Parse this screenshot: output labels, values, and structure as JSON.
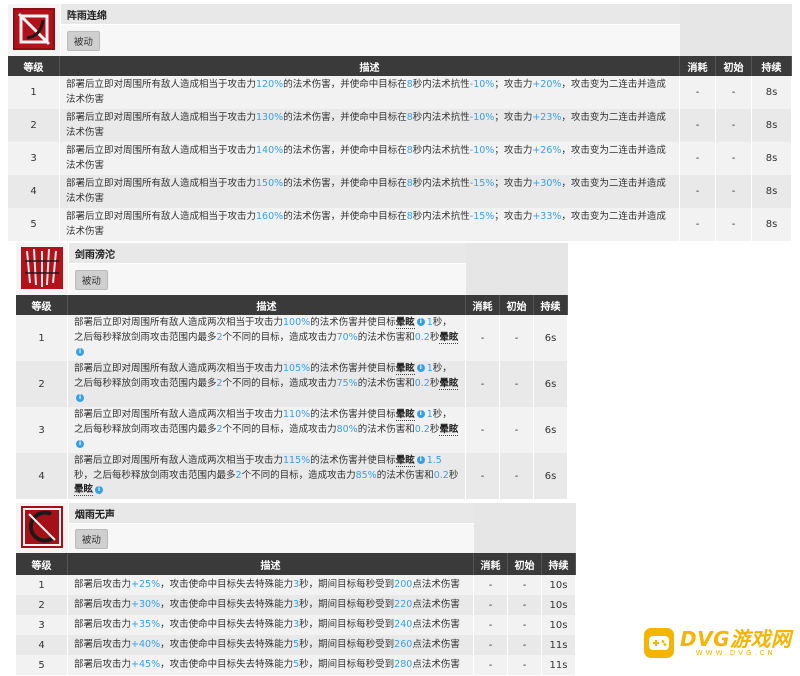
{
  "headers": {
    "level": "等级",
    "desc": "描述",
    "sp_cost": "消耗",
    "init_sp": "初始",
    "duration": "持续"
  },
  "skills": [
    {
      "name": "阵雨连绵",
      "tag": "被动",
      "icon": "skill-emblem-icon",
      "rows": [
        {
          "level": "1",
          "sp_cost": "-",
          "init_sp": "-",
          "duration": "8s",
          "desc": [
            [
              "部署后立即对周围所有敌人造成相当于攻击力",
              ""
            ],
            [
              "120%",
              "hl"
            ],
            [
              "的法术伤害，并使命中目标在",
              ""
            ],
            [
              "8",
              "hl"
            ],
            [
              "秒内法术抗性",
              ""
            ],
            [
              "-10%",
              "hl"
            ],
            [
              "；攻击力",
              ""
            ],
            [
              "+20%",
              "hl"
            ],
            [
              "，攻击变为二连击并造成法术伤害",
              ""
            ]
          ]
        },
        {
          "level": "2",
          "sp_cost": "-",
          "init_sp": "-",
          "duration": "8s",
          "desc": [
            [
              "部署后立即对周围所有敌人造成相当于攻击力",
              ""
            ],
            [
              "130%",
              "hl"
            ],
            [
              "的法术伤害，并使命中目标在",
              ""
            ],
            [
              "8",
              "hl"
            ],
            [
              "秒内法术抗性",
              ""
            ],
            [
              "-10%",
              "hl"
            ],
            [
              "；攻击力",
              ""
            ],
            [
              "+23%",
              "hl"
            ],
            [
              "，攻击变为二连击并造成法术伤害",
              ""
            ]
          ]
        },
        {
          "level": "3",
          "sp_cost": "-",
          "init_sp": "-",
          "duration": "8s",
          "desc": [
            [
              "部署后立即对周围所有敌人造成相当于攻击力",
              ""
            ],
            [
              "140%",
              "hl"
            ],
            [
              "的法术伤害，并使命中目标在",
              ""
            ],
            [
              "8",
              "hl"
            ],
            [
              "秒内法术抗性",
              ""
            ],
            [
              "-10%",
              "hl"
            ],
            [
              "；攻击力",
              ""
            ],
            [
              "+26%",
              "hl"
            ],
            [
              "，攻击变为二连击并造成法术伤害",
              ""
            ]
          ]
        },
        {
          "level": "4",
          "sp_cost": "-",
          "init_sp": "-",
          "duration": "8s",
          "desc": [
            [
              "部署后立即对周围所有敌人造成相当于攻击力",
              ""
            ],
            [
              "150%",
              "hl"
            ],
            [
              "的法术伤害，并使命中目标在",
              ""
            ],
            [
              "8",
              "hl"
            ],
            [
              "秒内法术抗性",
              ""
            ],
            [
              "-15%",
              "hl"
            ],
            [
              "；攻击力",
              ""
            ],
            [
              "+30%",
              "hl"
            ],
            [
              "，攻击变为二连击并造成法术伤害",
              ""
            ]
          ]
        },
        {
          "level": "5",
          "sp_cost": "-",
          "init_sp": "-",
          "duration": "8s",
          "desc": [
            [
              "部署后立即对周围所有敌人造成相当于攻击力",
              ""
            ],
            [
              "160%",
              "hl"
            ],
            [
              "的法术伤害，并使命中目标在",
              ""
            ],
            [
              "8",
              "hl"
            ],
            [
              "秒内法术抗性",
              ""
            ],
            [
              "-15%",
              "hl"
            ],
            [
              "；攻击力",
              ""
            ],
            [
              "+33%",
              "hl"
            ],
            [
              "，攻击变为二连击并造成法术伤害",
              ""
            ]
          ]
        }
      ]
    },
    {
      "name": "剑雨滂沱",
      "tag": "被动",
      "icon": "skill-sword-rain-icon",
      "rows": [
        {
          "level": "1",
          "sp_cost": "-",
          "init_sp": "-",
          "duration": "6s",
          "desc": [
            [
              "部署后立即对周围所有敌人造成两次相当于攻击力",
              ""
            ],
            [
              "100%",
              "hl"
            ],
            [
              "的法术伤害并使目标",
              ""
            ],
            [
              "晕眩",
              "kw"
            ],
            [
              "i",
              "info"
            ],
            [
              "1",
              "hl"
            ],
            [
              "秒，之后每秒释放剑雨攻击范围内最多",
              ""
            ],
            [
              "2",
              "hl"
            ],
            [
              "个不同的目标，造成攻击力",
              ""
            ],
            [
              "70%",
              "hl"
            ],
            [
              "的法术伤害和",
              ""
            ],
            [
              "0.2",
              "hl"
            ],
            [
              "秒",
              ""
            ],
            [
              "晕眩",
              "kw"
            ],
            [
              "i",
              "info"
            ]
          ]
        },
        {
          "level": "2",
          "sp_cost": "-",
          "init_sp": "-",
          "duration": "6s",
          "desc": [
            [
              "部署后立即对周围所有敌人造成两次相当于攻击力",
              ""
            ],
            [
              "105%",
              "hl"
            ],
            [
              "的法术伤害并使目标",
              ""
            ],
            [
              "晕眩",
              "kw"
            ],
            [
              "i",
              "info"
            ],
            [
              "1",
              "hl"
            ],
            [
              "秒，之后每秒释放剑雨攻击范围内最多",
              ""
            ],
            [
              "2",
              "hl"
            ],
            [
              "个不同的目标，造成攻击力",
              ""
            ],
            [
              "75%",
              "hl"
            ],
            [
              "的法术伤害和",
              ""
            ],
            [
              "0.2",
              "hl"
            ],
            [
              "秒",
              ""
            ],
            [
              "晕眩",
              "kw"
            ],
            [
              "i",
              "info"
            ]
          ]
        },
        {
          "level": "3",
          "sp_cost": "-",
          "init_sp": "-",
          "duration": "6s",
          "desc": [
            [
              "部署后立即对周围所有敌人造成两次相当于攻击力",
              ""
            ],
            [
              "110%",
              "hl"
            ],
            [
              "的法术伤害并使目标",
              ""
            ],
            [
              "晕眩",
              "kw"
            ],
            [
              "i",
              "info"
            ],
            [
              "1",
              "hl"
            ],
            [
              "秒，之后每秒释放剑雨攻击范围内最多",
              ""
            ],
            [
              "2",
              "hl"
            ],
            [
              "个不同的目标，造成攻击力",
              ""
            ],
            [
              "80%",
              "hl"
            ],
            [
              "的法术伤害和",
              ""
            ],
            [
              "0.2",
              "hl"
            ],
            [
              "秒",
              ""
            ],
            [
              "晕眩",
              "kw"
            ],
            [
              "i",
              "info"
            ]
          ]
        },
        {
          "level": "4",
          "sp_cost": "-",
          "init_sp": "-",
          "duration": "6s",
          "desc": [
            [
              "部署后立即对周围所有敌人造成两次相当于攻击力",
              ""
            ],
            [
              "115%",
              "hl"
            ],
            [
              "的法术伤害并使目标",
              ""
            ],
            [
              "晕眩",
              "kw"
            ],
            [
              "i",
              "info"
            ],
            [
              "1.5",
              "hl"
            ],
            [
              "秒，之后每秒释放剑雨攻击范围内最多",
              ""
            ],
            [
              "2",
              "hl"
            ],
            [
              "个不同的目标，造成攻击力",
              ""
            ],
            [
              "85%",
              "hl"
            ],
            [
              "的法术伤害和",
              ""
            ],
            [
              "0.2",
              "hl"
            ],
            [
              "秒",
              ""
            ],
            [
              "晕眩",
              "kw"
            ],
            [
              "i",
              "info"
            ]
          ]
        }
      ]
    },
    {
      "name": "烟雨无声",
      "tag": "被动",
      "icon": "skill-crescent-icon",
      "rows": [
        {
          "level": "1",
          "sp_cost": "-",
          "init_sp": "-",
          "duration": "10s",
          "desc": [
            [
              "部署后攻击力",
              ""
            ],
            [
              "+25%",
              "hl"
            ],
            [
              "，攻击使命中目标失去特殊能力",
              ""
            ],
            [
              "3",
              "hl"
            ],
            [
              "秒，期间目标每秒受到",
              ""
            ],
            [
              "200",
              "hl"
            ],
            [
              "点法术伤害",
              ""
            ]
          ]
        },
        {
          "level": "2",
          "sp_cost": "-",
          "init_sp": "-",
          "duration": "10s",
          "desc": [
            [
              "部署后攻击力",
              ""
            ],
            [
              "+30%",
              "hl"
            ],
            [
              "，攻击使命中目标失去特殊能力",
              ""
            ],
            [
              "3",
              "hl"
            ],
            [
              "秒，期间目标每秒受到",
              ""
            ],
            [
              "220",
              "hl"
            ],
            [
              "点法术伤害",
              ""
            ]
          ]
        },
        {
          "level": "3",
          "sp_cost": "-",
          "init_sp": "-",
          "duration": "10s",
          "desc": [
            [
              "部署后攻击力",
              ""
            ],
            [
              "+35%",
              "hl"
            ],
            [
              "，攻击使命中目标失去特殊能力",
              ""
            ],
            [
              "3",
              "hl"
            ],
            [
              "秒，期间目标每秒受到",
              ""
            ],
            [
              "240",
              "hl"
            ],
            [
              "点法术伤害",
              ""
            ]
          ]
        },
        {
          "level": "4",
          "sp_cost": "-",
          "init_sp": "-",
          "duration": "11s",
          "desc": [
            [
              "部署后攻击力",
              ""
            ],
            [
              "+40%",
              "hl"
            ],
            [
              "，攻击使命中目标失去特殊能力",
              ""
            ],
            [
              "5",
              "hl"
            ],
            [
              "秒，期间目标每秒受到",
              ""
            ],
            [
              "260",
              "hl"
            ],
            [
              "点法术伤害",
              ""
            ]
          ]
        },
        {
          "level": "5",
          "sp_cost": "-",
          "init_sp": "-",
          "duration": "11s",
          "desc": [
            [
              "部署后攻击力",
              ""
            ],
            [
              "+45%",
              "hl"
            ],
            [
              "，攻击使命中目标失去特殊能力",
              ""
            ],
            [
              "5",
              "hl"
            ],
            [
              "秒，期间目标每秒受到",
              ""
            ],
            [
              "280",
              "hl"
            ],
            [
              "点法术伤害",
              ""
            ]
          ]
        }
      ]
    }
  ],
  "watermark": {
    "main": "DVG游戏网",
    "sub": "WWW.DVG.CN",
    "icon": "gamepad-icon",
    "color": "#f5b400"
  },
  "colors": {
    "highlight": "#3aa0e6",
    "header_bg": "#3a3a3a",
    "icon_red": "#b3121b"
  }
}
